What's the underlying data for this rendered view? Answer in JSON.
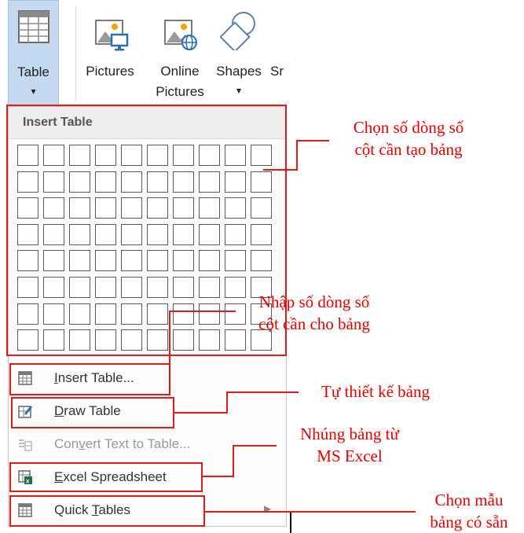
{
  "ribbon": {
    "table_label": "Table",
    "pictures_label": "Pictures",
    "online_pictures_label1": "Online",
    "online_pictures_label2": "Pictures",
    "shapes_label": "Shapes",
    "smartart_label": "Sr"
  },
  "menu": {
    "header": "Insert Table",
    "grid": {
      "rows": 8,
      "cols": 10
    },
    "items": [
      {
        "label": "Insert Table...",
        "icon": "table-icon",
        "disabled": false
      },
      {
        "label": "Draw Table",
        "icon": "draw-table-icon",
        "disabled": false
      },
      {
        "label": "Convert Text to Table...",
        "icon": "convert-text-icon",
        "disabled": true
      },
      {
        "label": "Excel Spreadsheet",
        "icon": "excel-icon",
        "disabled": false
      },
      {
        "label": "Quick Tables",
        "icon": "quick-tables-icon",
        "disabled": false
      }
    ]
  },
  "annotations": {
    "grid_note_line1": "Chọn số dòng số",
    "grid_note_line2": "cột cần tạo bảng",
    "insert_note_line1": "Nhập số dòng số",
    "insert_note_line2": "cột cần cho bảng",
    "draw_note": "Tự thiết kế bảng",
    "excel_note_line1": "Nhúng bảng từ",
    "excel_note_line2": "MS Excel",
    "quick_note_line1": "Chọn mẫu",
    "quick_note_line2": "bảng có sẵn"
  },
  "colors": {
    "annotation": "#e31a1a",
    "table_button_bg": "#c5d9f1"
  }
}
